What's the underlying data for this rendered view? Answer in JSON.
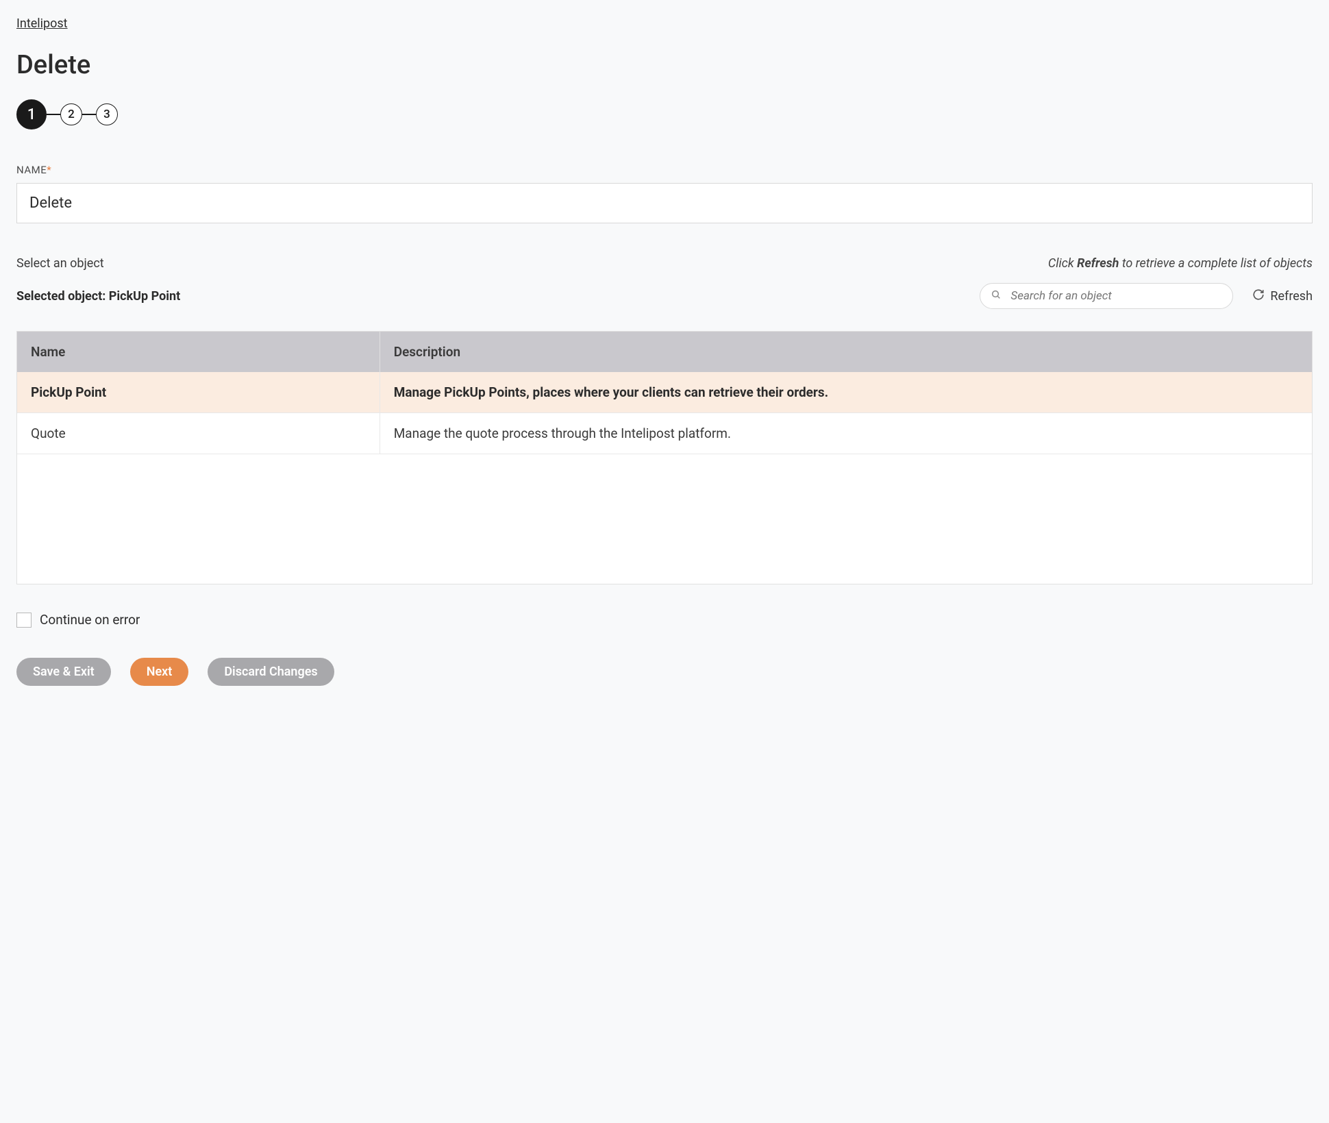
{
  "breadcrumb": {
    "label": "Intelipost"
  },
  "page_title": "Delete",
  "stepper": {
    "steps": [
      "1",
      "2",
      "3"
    ],
    "active_index": 0
  },
  "name_field": {
    "label": "NAME",
    "required_marker": "*",
    "value": "Delete"
  },
  "select_object_label": "Select an object",
  "hint": {
    "prefix": "Click ",
    "bold": "Refresh",
    "suffix": " to retrieve a complete list of objects"
  },
  "selected_object": {
    "prefix": "Selected object: ",
    "name": "PickUp Point"
  },
  "search": {
    "placeholder": "Search for an object"
  },
  "refresh_label": "Refresh",
  "table": {
    "headers": {
      "name": "Name",
      "description": "Description"
    },
    "rows": [
      {
        "name": "PickUp Point",
        "description": "Manage PickUp Points, places where your clients can retrieve their orders.",
        "selected": true
      },
      {
        "name": "Quote",
        "description": "Manage the quote process through the Intelipost platform.",
        "selected": false
      }
    ]
  },
  "continue_on_error": {
    "label": "Continue on error",
    "checked": false
  },
  "buttons": {
    "save_exit": "Save & Exit",
    "next": "Next",
    "discard": "Discard Changes"
  }
}
